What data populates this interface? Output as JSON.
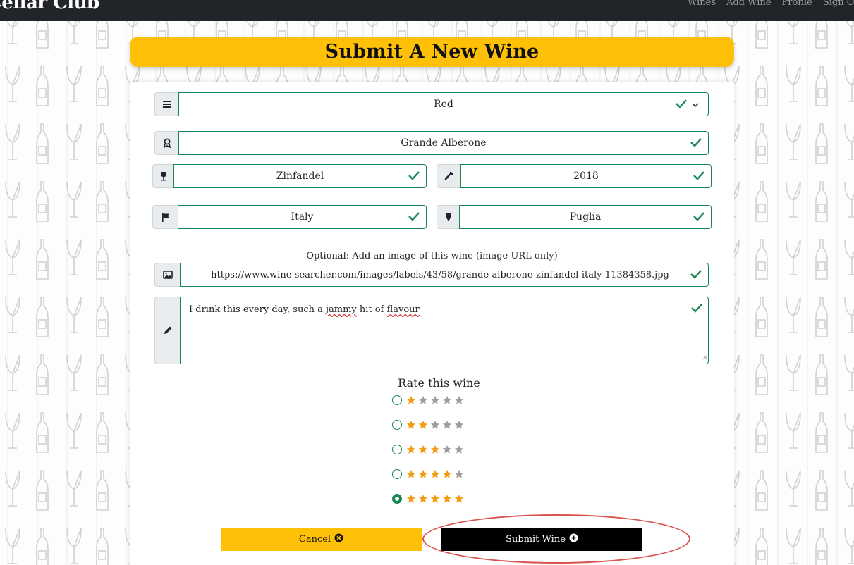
{
  "nav": {
    "brand": "Cellar Club",
    "links": [
      "Wines",
      "Add Wine",
      "Profile",
      "Sign Out"
    ]
  },
  "header": {
    "title": "Submit A New Wine"
  },
  "form": {
    "type": {
      "value": "Red",
      "icon": "list-icon"
    },
    "winery": {
      "value": "Grande Alberone",
      "icon": "award-icon"
    },
    "grape": {
      "value": "Zinfandel",
      "icon": "wine-glass-icon"
    },
    "year": {
      "value": "2018",
      "icon": "wine-bottle-icon"
    },
    "country": {
      "value": "Italy",
      "icon": "flag-icon"
    },
    "region": {
      "value": "Puglia",
      "icon": "map-pin-icon"
    },
    "image_label": "Optional: Add an image of this wine (image URL only)",
    "image_url": {
      "value": "https://www.wine-searcher.com/images/labels/43/58/grande-alberone-zinfandel-italy-11384358.jpg",
      "icon": "image-icon"
    },
    "notes": {
      "before": "I drink this every day, such a ",
      "word1": "jammy",
      "middle": " hit of ",
      "word2": "flavour",
      "icon": "pencil-icon"
    },
    "rating_title": "Rate this wine",
    "rating_options": [
      1,
      2,
      3,
      4,
      5
    ],
    "rating_selected": 5
  },
  "buttons": {
    "cancel": "Cancel",
    "submit": "Submit Wine"
  },
  "colors": {
    "accent": "#ffc107",
    "valid": "#198754",
    "star_on": "#f39c12",
    "star_off": "#9e9e9e",
    "highlight": "#d9534f"
  }
}
